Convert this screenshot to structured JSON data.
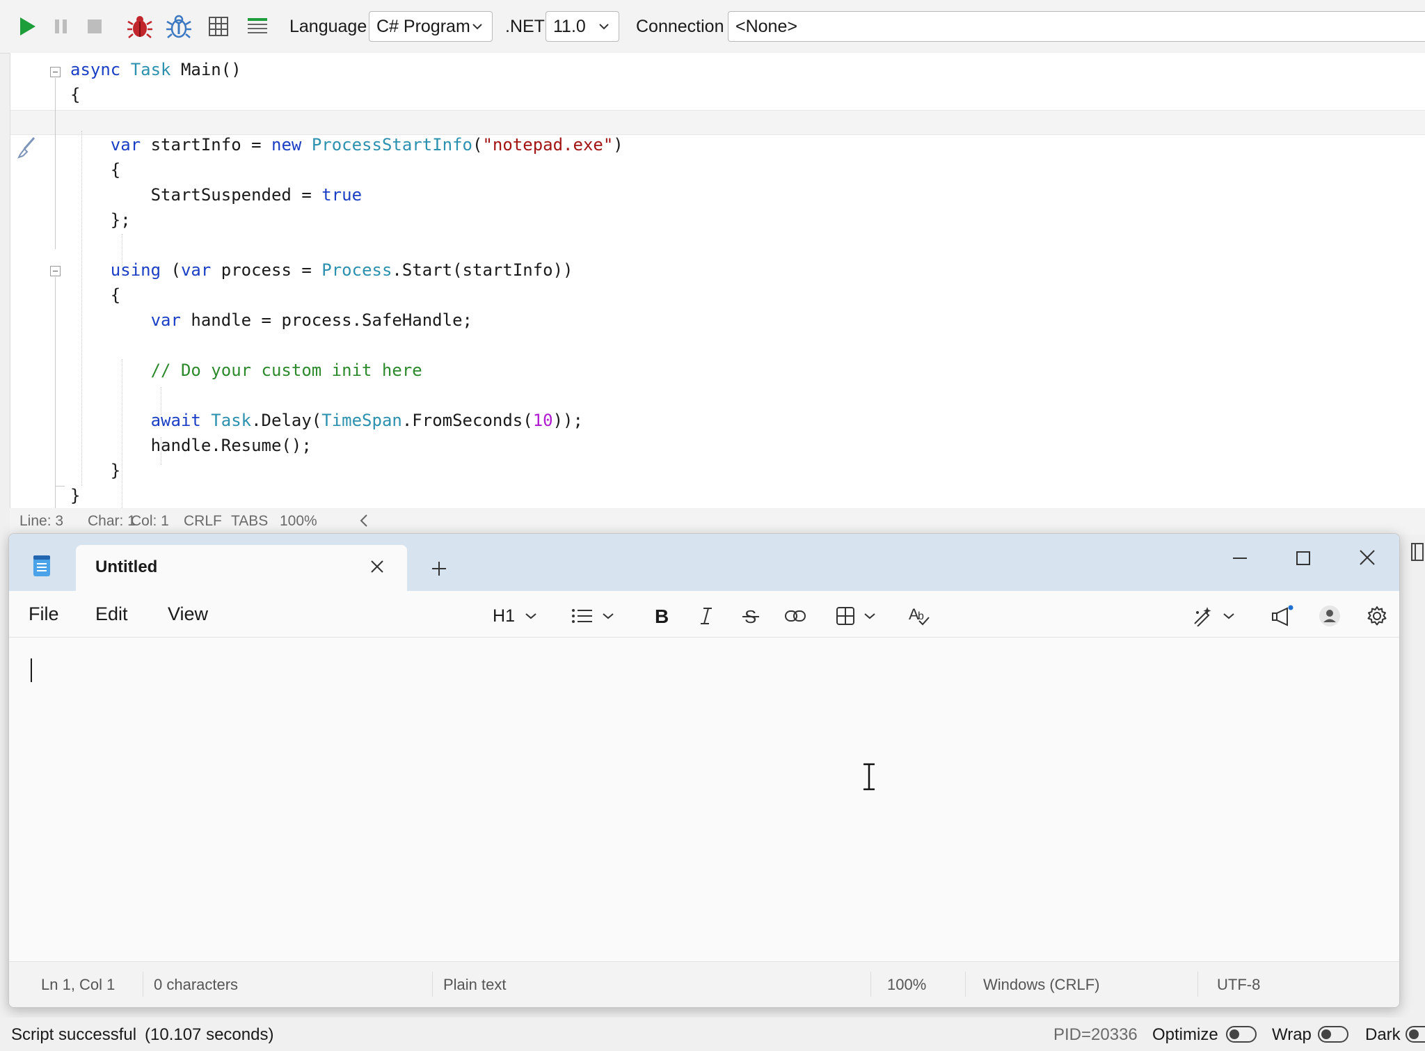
{
  "toolbar": {
    "language_label": "Language",
    "language_value": "C# Program",
    "dotnet_label": ".NET",
    "dotnet_value": "11.0",
    "connection_label": "Connection",
    "connection_value": "<None>"
  },
  "editor": {
    "lines": [
      "async Task Main()",
      "{",
      "",
      "    var startInfo = new ProcessStartInfo(\"notepad.exe\")",
      "    {",
      "        StartSuspended = true",
      "    };",
      "",
      "    using (var process = Process.Start(startInfo))",
      "    {",
      "        var handle = process.SafeHandle;",
      "",
      "        // Do your custom init here",
      "",
      "        await Task.Delay(TimeSpan.FromSeconds(10));",
      "        handle.Resume();",
      "    }",
      "}"
    ],
    "status": {
      "line": "Line: 3",
      "char": "Char: 1",
      "col": "Col: 1",
      "eol": "CRLF",
      "indent": "TABS",
      "zoom": "100%"
    }
  },
  "notepad": {
    "tab_title": "Untitled",
    "menu": [
      "File",
      "Edit",
      "View"
    ],
    "heading_label": "H1",
    "text": "",
    "status": {
      "position": "Ln 1, Col 1",
      "characters": "0 characters",
      "format": "Plain text",
      "zoom": "100%",
      "line_ending": "Windows (CRLF)",
      "encoding": "UTF-8"
    }
  },
  "app_status": {
    "message": "Script successful",
    "duration": "(10.107 seconds)",
    "pid": "PID=20336",
    "optimize_label": "Optimize",
    "wrap_label": "Wrap",
    "dark_label": "Dark"
  },
  "colors": {
    "keyword": "#1a3fc4",
    "type": "#2b91af",
    "string": "#a31515",
    "comment": "#2c8a2c",
    "number": "#b11bd1",
    "run_green": "#1e9e3a",
    "bug_red": "#c0262b",
    "notepad_titlebar": "#d7e4f0"
  },
  "icons": [
    "run-icon",
    "pause-icon",
    "stop-icon",
    "debug-bug-icon",
    "debug-step-icon",
    "grid-results-icon",
    "text-results-icon",
    "chevron-down-icon",
    "collapse-icon",
    "brush-icon",
    "notepad-app-icon",
    "close-icon",
    "plus-icon",
    "minimize-icon",
    "maximize-icon",
    "list-icon",
    "bold-icon",
    "italic-icon",
    "strikethrough-icon",
    "link-icon",
    "table-icon",
    "spellcheck-icon",
    "copilot-icon",
    "megaphone-icon",
    "profile-icon",
    "gear-icon",
    "text-cursor-icon"
  ]
}
